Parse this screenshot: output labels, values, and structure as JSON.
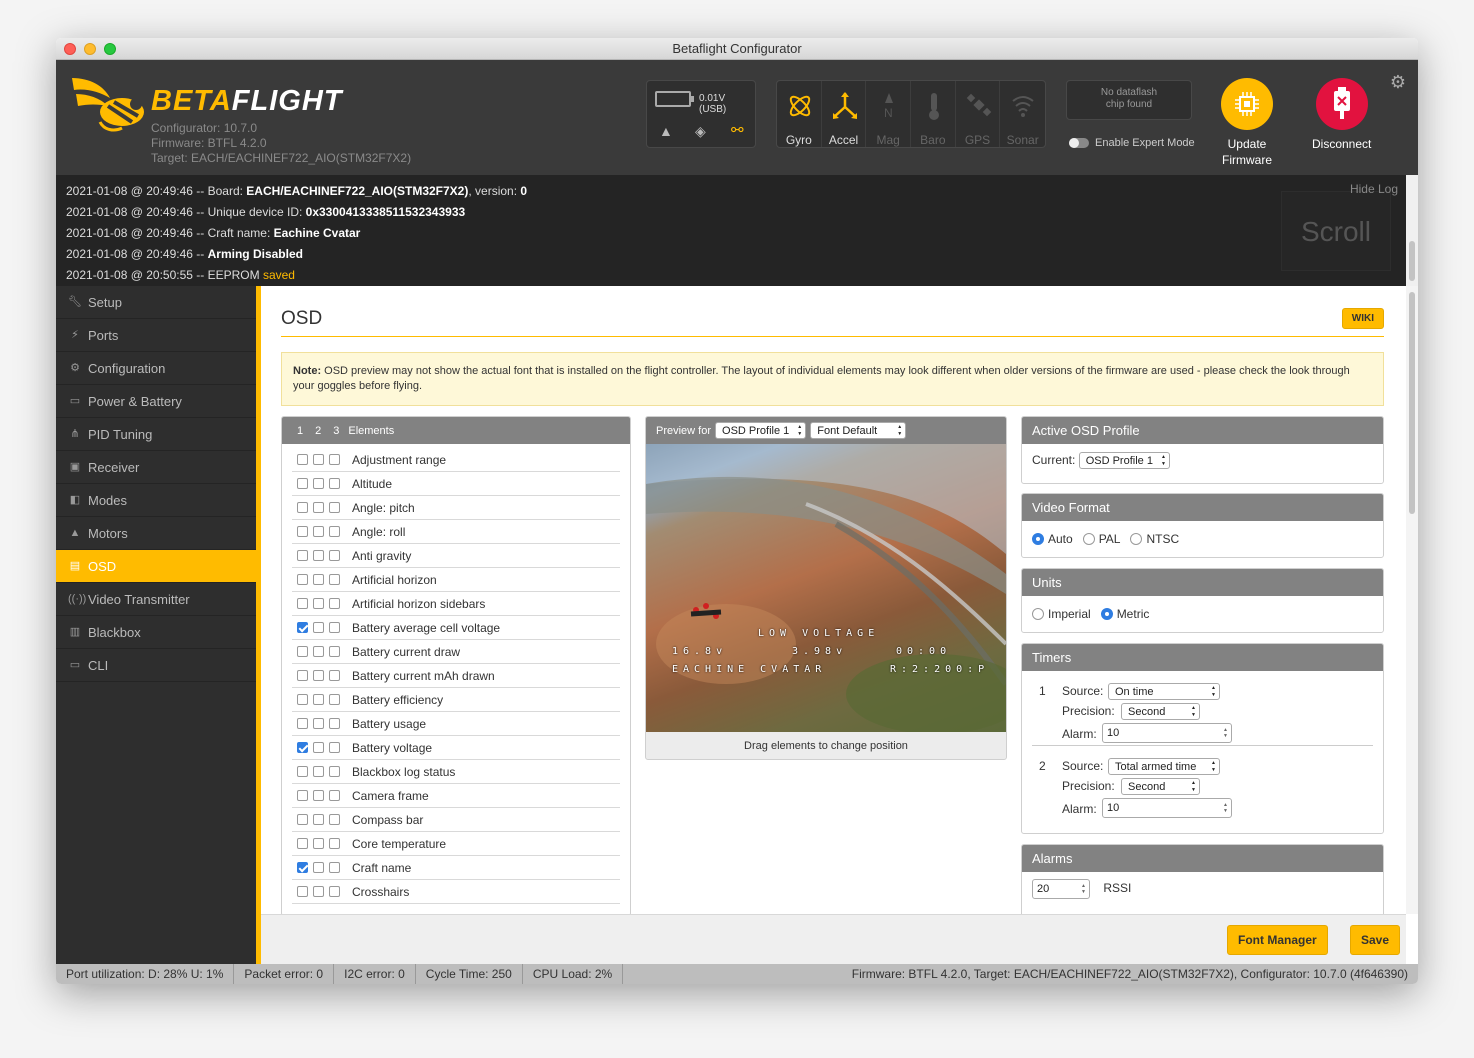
{
  "window_title": "Betaflight Configurator",
  "brand": {
    "part1": "BETA",
    "part2": "FLIGHT"
  },
  "version": {
    "configurator": "Configurator: 10.7.0",
    "firmware": "Firmware: BTFL 4.2.0",
    "target": "Target: EACH/EACHINEF722_AIO(STM32F7X2)"
  },
  "battery": {
    "voltage": "0.01V (USB)"
  },
  "sensors": [
    {
      "label": "Gyro",
      "active": true
    },
    {
      "label": "Accel",
      "active": true
    },
    {
      "label": "Mag",
      "active": false
    },
    {
      "label": "Baro",
      "active": false
    },
    {
      "label": "GPS",
      "active": false
    },
    {
      "label": "Sonar",
      "active": false
    }
  ],
  "dataflash": {
    "line1": "No dataflash",
    "line2": "chip found"
  },
  "expert_mode": "Enable Expert Mode",
  "update_firmware": {
    "line1": "Update",
    "line2": "Firmware"
  },
  "disconnect": "Disconnect",
  "log": {
    "hide": "Hide Log",
    "scroll": "Scroll",
    "lines": [
      {
        "prefix": "2021-01-08 @ 20:49:46 -- Board: ",
        "bold": "EACH/EACHINEF722_AIO(STM32F7X2)",
        "mid": ", version: ",
        "bold2": "0"
      },
      {
        "prefix": "2021-01-08 @ 20:49:46 -- Unique device ID: ",
        "bold": "0x330041333851153234393​3",
        "mid": "",
        "bold2": ""
      },
      {
        "prefix": "2021-01-08 @ 20:49:46 -- Craft name: ",
        "bold": "Eachine Cvatar",
        "mid": "",
        "bold2": ""
      },
      {
        "prefix": "2021-01-08 @ 20:49:46 -- ",
        "bold": "Arming Disabled",
        "mid": "",
        "bold2": ""
      }
    ],
    "last": {
      "prefix": "2021-01-08 @ 20:50:55 -- EEPROM ",
      "highlight": "saved"
    }
  },
  "nav": [
    {
      "label": "Setup",
      "icon": "wrench-icon"
    },
    {
      "label": "Ports",
      "icon": "plug-icon"
    },
    {
      "label": "Configuration",
      "icon": "gear-icon"
    },
    {
      "label": "Power & Battery",
      "icon": "battery-icon"
    },
    {
      "label": "PID Tuning",
      "icon": "sitemap-icon"
    },
    {
      "label": "Receiver",
      "icon": "receiver-icon"
    },
    {
      "label": "Modes",
      "icon": "toggles-icon"
    },
    {
      "label": "Motors",
      "icon": "motor-icon"
    },
    {
      "label": "OSD",
      "icon": "osd-icon",
      "active": true
    },
    {
      "label": "Video Transmitter",
      "icon": "antenna-icon"
    },
    {
      "label": "Blackbox",
      "icon": "blackbox-icon"
    },
    {
      "label": "CLI",
      "icon": "terminal-icon"
    }
  ],
  "page": {
    "title": "OSD",
    "wiki": "WIKI",
    "note_bold": "Note:",
    "note_text": " OSD preview may not show the actual font that is installed on the flight controller. The layout of individual elements may look different when older versions of the firmware are used - please check the look through your goggles before flying."
  },
  "elements": {
    "profiles": [
      "1",
      "2",
      "3"
    ],
    "header": "Elements",
    "items": [
      {
        "name": "Adjustment range",
        "on": false
      },
      {
        "name": "Altitude",
        "on": false
      },
      {
        "name": "Angle: pitch",
        "on": false
      },
      {
        "name": "Angle: roll",
        "on": false
      },
      {
        "name": "Anti gravity",
        "on": false
      },
      {
        "name": "Artificial horizon",
        "on": false
      },
      {
        "name": "Artificial horizon sidebars",
        "on": false
      },
      {
        "name": "Battery average cell voltage",
        "on": true
      },
      {
        "name": "Battery current draw",
        "on": false
      },
      {
        "name": "Battery current mAh drawn",
        "on": false
      },
      {
        "name": "Battery efficiency",
        "on": false
      },
      {
        "name": "Battery usage",
        "on": false
      },
      {
        "name": "Battery voltage",
        "on": true
      },
      {
        "name": "Blackbox log status",
        "on": false
      },
      {
        "name": "Camera frame",
        "on": false
      },
      {
        "name": "Compass bar",
        "on": false
      },
      {
        "name": "Core temperature",
        "on": false
      },
      {
        "name": "Craft name",
        "on": true
      },
      {
        "name": "Crosshairs",
        "on": false
      }
    ]
  },
  "preview": {
    "label": "Preview for",
    "profile": "OSD Profile 1",
    "font": "Font Default",
    "footer": "Drag elements to change position",
    "osd": {
      "warning": "LOW VOLTAGE",
      "voltage": "16.8v",
      "cell": "3.98v",
      "timer": "00:00",
      "craft": "EACHINE CVATAR",
      "rssi": "R:2:200:P"
    }
  },
  "active_profile": {
    "title": "Active OSD Profile",
    "label": "Current:",
    "value": "OSD Profile 1"
  },
  "video_format": {
    "title": "Video Format",
    "options": [
      {
        "label": "Auto",
        "on": true
      },
      {
        "label": "PAL",
        "on": false
      },
      {
        "label": "NTSC",
        "on": false
      }
    ]
  },
  "units": {
    "title": "Units",
    "options": [
      {
        "label": "Imperial",
        "on": false
      },
      {
        "label": "Metric",
        "on": true
      }
    ]
  },
  "timers": {
    "title": "Timers",
    "source_label": "Source:",
    "precision_label": "Precision:",
    "alarm_label": "Alarm:",
    "items": [
      {
        "num": "1",
        "source": "On time",
        "precision": "Second",
        "alarm": "10"
      },
      {
        "num": "2",
        "source": "Total armed time",
        "precision": "Second",
        "alarm": "10"
      }
    ]
  },
  "alarms": {
    "title": "Alarms",
    "value": "20",
    "label": "RSSI"
  },
  "buttons": {
    "font_manager": "Font Manager",
    "save": "Save"
  },
  "status": {
    "port": "Port utilization: D: 28% U: 1%",
    "packet": "Packet error: 0",
    "i2c": "I2C error: 0",
    "cycle": "Cycle Time: 250",
    "cpu": "CPU Load: 2%",
    "firmware": "Firmware: BTFL 4.2.0, Target: EACH/EACHINEF722_AIO(STM32F7X2), Configurator: 10.7.0 (4f646390)"
  },
  "colors": {
    "accent": "#ffbb00",
    "header": "#3a3a3a",
    "sidebar": "#2e2e2e",
    "disconnect": "#e2123f"
  }
}
